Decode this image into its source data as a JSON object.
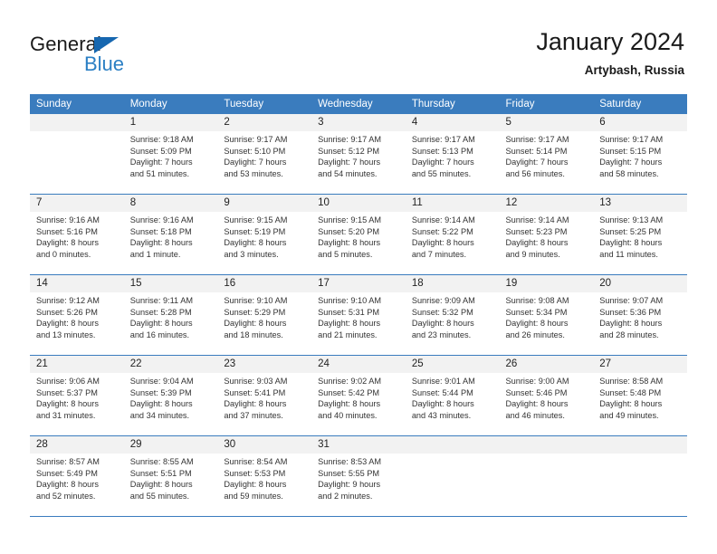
{
  "brand": {
    "name_part1": "General",
    "name_part2": "Blue",
    "triangle_icon": "triangle-icon",
    "accent_color": "#2b7fc4"
  },
  "header": {
    "title": "January 2024",
    "subtitle": "Artybash, Russia"
  },
  "calendar": {
    "header_bg": "#3a7cbe",
    "daynum_bg": "#f2f2f2",
    "weekday_headers": [
      "Sunday",
      "Monday",
      "Tuesday",
      "Wednesday",
      "Thursday",
      "Friday",
      "Saturday"
    ],
    "weeks": [
      [
        {
          "day": "",
          "sunrise": "",
          "sunset": "",
          "daylight_line1": "",
          "daylight_line2": ""
        },
        {
          "day": "1",
          "sunrise": "Sunrise: 9:18 AM",
          "sunset": "Sunset: 5:09 PM",
          "daylight_line1": "Daylight: 7 hours",
          "daylight_line2": "and 51 minutes."
        },
        {
          "day": "2",
          "sunrise": "Sunrise: 9:17 AM",
          "sunset": "Sunset: 5:10 PM",
          "daylight_line1": "Daylight: 7 hours",
          "daylight_line2": "and 53 minutes."
        },
        {
          "day": "3",
          "sunrise": "Sunrise: 9:17 AM",
          "sunset": "Sunset: 5:12 PM",
          "daylight_line1": "Daylight: 7 hours",
          "daylight_line2": "and 54 minutes."
        },
        {
          "day": "4",
          "sunrise": "Sunrise: 9:17 AM",
          "sunset": "Sunset: 5:13 PM",
          "daylight_line1": "Daylight: 7 hours",
          "daylight_line2": "and 55 minutes."
        },
        {
          "day": "5",
          "sunrise": "Sunrise: 9:17 AM",
          "sunset": "Sunset: 5:14 PM",
          "daylight_line1": "Daylight: 7 hours",
          "daylight_line2": "and 56 minutes."
        },
        {
          "day": "6",
          "sunrise": "Sunrise: 9:17 AM",
          "sunset": "Sunset: 5:15 PM",
          "daylight_line1": "Daylight: 7 hours",
          "daylight_line2": "and 58 minutes."
        }
      ],
      [
        {
          "day": "7",
          "sunrise": "Sunrise: 9:16 AM",
          "sunset": "Sunset: 5:16 PM",
          "daylight_line1": "Daylight: 8 hours",
          "daylight_line2": "and 0 minutes."
        },
        {
          "day": "8",
          "sunrise": "Sunrise: 9:16 AM",
          "sunset": "Sunset: 5:18 PM",
          "daylight_line1": "Daylight: 8 hours",
          "daylight_line2": "and 1 minute."
        },
        {
          "day": "9",
          "sunrise": "Sunrise: 9:15 AM",
          "sunset": "Sunset: 5:19 PM",
          "daylight_line1": "Daylight: 8 hours",
          "daylight_line2": "and 3 minutes."
        },
        {
          "day": "10",
          "sunrise": "Sunrise: 9:15 AM",
          "sunset": "Sunset: 5:20 PM",
          "daylight_line1": "Daylight: 8 hours",
          "daylight_line2": "and 5 minutes."
        },
        {
          "day": "11",
          "sunrise": "Sunrise: 9:14 AM",
          "sunset": "Sunset: 5:22 PM",
          "daylight_line1": "Daylight: 8 hours",
          "daylight_line2": "and 7 minutes."
        },
        {
          "day": "12",
          "sunrise": "Sunrise: 9:14 AM",
          "sunset": "Sunset: 5:23 PM",
          "daylight_line1": "Daylight: 8 hours",
          "daylight_line2": "and 9 minutes."
        },
        {
          "day": "13",
          "sunrise": "Sunrise: 9:13 AM",
          "sunset": "Sunset: 5:25 PM",
          "daylight_line1": "Daylight: 8 hours",
          "daylight_line2": "and 11 minutes."
        }
      ],
      [
        {
          "day": "14",
          "sunrise": "Sunrise: 9:12 AM",
          "sunset": "Sunset: 5:26 PM",
          "daylight_line1": "Daylight: 8 hours",
          "daylight_line2": "and 13 minutes."
        },
        {
          "day": "15",
          "sunrise": "Sunrise: 9:11 AM",
          "sunset": "Sunset: 5:28 PM",
          "daylight_line1": "Daylight: 8 hours",
          "daylight_line2": "and 16 minutes."
        },
        {
          "day": "16",
          "sunrise": "Sunrise: 9:10 AM",
          "sunset": "Sunset: 5:29 PM",
          "daylight_line1": "Daylight: 8 hours",
          "daylight_line2": "and 18 minutes."
        },
        {
          "day": "17",
          "sunrise": "Sunrise: 9:10 AM",
          "sunset": "Sunset: 5:31 PM",
          "daylight_line1": "Daylight: 8 hours",
          "daylight_line2": "and 21 minutes."
        },
        {
          "day": "18",
          "sunrise": "Sunrise: 9:09 AM",
          "sunset": "Sunset: 5:32 PM",
          "daylight_line1": "Daylight: 8 hours",
          "daylight_line2": "and 23 minutes."
        },
        {
          "day": "19",
          "sunrise": "Sunrise: 9:08 AM",
          "sunset": "Sunset: 5:34 PM",
          "daylight_line1": "Daylight: 8 hours",
          "daylight_line2": "and 26 minutes."
        },
        {
          "day": "20",
          "sunrise": "Sunrise: 9:07 AM",
          "sunset": "Sunset: 5:36 PM",
          "daylight_line1": "Daylight: 8 hours",
          "daylight_line2": "and 28 minutes."
        }
      ],
      [
        {
          "day": "21",
          "sunrise": "Sunrise: 9:06 AM",
          "sunset": "Sunset: 5:37 PM",
          "daylight_line1": "Daylight: 8 hours",
          "daylight_line2": "and 31 minutes."
        },
        {
          "day": "22",
          "sunrise": "Sunrise: 9:04 AM",
          "sunset": "Sunset: 5:39 PM",
          "daylight_line1": "Daylight: 8 hours",
          "daylight_line2": "and 34 minutes."
        },
        {
          "day": "23",
          "sunrise": "Sunrise: 9:03 AM",
          "sunset": "Sunset: 5:41 PM",
          "daylight_line1": "Daylight: 8 hours",
          "daylight_line2": "and 37 minutes."
        },
        {
          "day": "24",
          "sunrise": "Sunrise: 9:02 AM",
          "sunset": "Sunset: 5:42 PM",
          "daylight_line1": "Daylight: 8 hours",
          "daylight_line2": "and 40 minutes."
        },
        {
          "day": "25",
          "sunrise": "Sunrise: 9:01 AM",
          "sunset": "Sunset: 5:44 PM",
          "daylight_line1": "Daylight: 8 hours",
          "daylight_line2": "and 43 minutes."
        },
        {
          "day": "26",
          "sunrise": "Sunrise: 9:00 AM",
          "sunset": "Sunset: 5:46 PM",
          "daylight_line1": "Daylight: 8 hours",
          "daylight_line2": "and 46 minutes."
        },
        {
          "day": "27",
          "sunrise": "Sunrise: 8:58 AM",
          "sunset": "Sunset: 5:48 PM",
          "daylight_line1": "Daylight: 8 hours",
          "daylight_line2": "and 49 minutes."
        }
      ],
      [
        {
          "day": "28",
          "sunrise": "Sunrise: 8:57 AM",
          "sunset": "Sunset: 5:49 PM",
          "daylight_line1": "Daylight: 8 hours",
          "daylight_line2": "and 52 minutes."
        },
        {
          "day": "29",
          "sunrise": "Sunrise: 8:55 AM",
          "sunset": "Sunset: 5:51 PM",
          "daylight_line1": "Daylight: 8 hours",
          "daylight_line2": "and 55 minutes."
        },
        {
          "day": "30",
          "sunrise": "Sunrise: 8:54 AM",
          "sunset": "Sunset: 5:53 PM",
          "daylight_line1": "Daylight: 8 hours",
          "daylight_line2": "and 59 minutes."
        },
        {
          "day": "31",
          "sunrise": "Sunrise: 8:53 AM",
          "sunset": "Sunset: 5:55 PM",
          "daylight_line1": "Daylight: 9 hours",
          "daylight_line2": "and 2 minutes."
        },
        {
          "day": "",
          "sunrise": "",
          "sunset": "",
          "daylight_line1": "",
          "daylight_line2": ""
        },
        {
          "day": "",
          "sunrise": "",
          "sunset": "",
          "daylight_line1": "",
          "daylight_line2": ""
        },
        {
          "day": "",
          "sunrise": "",
          "sunset": "",
          "daylight_line1": "",
          "daylight_line2": ""
        }
      ]
    ]
  }
}
